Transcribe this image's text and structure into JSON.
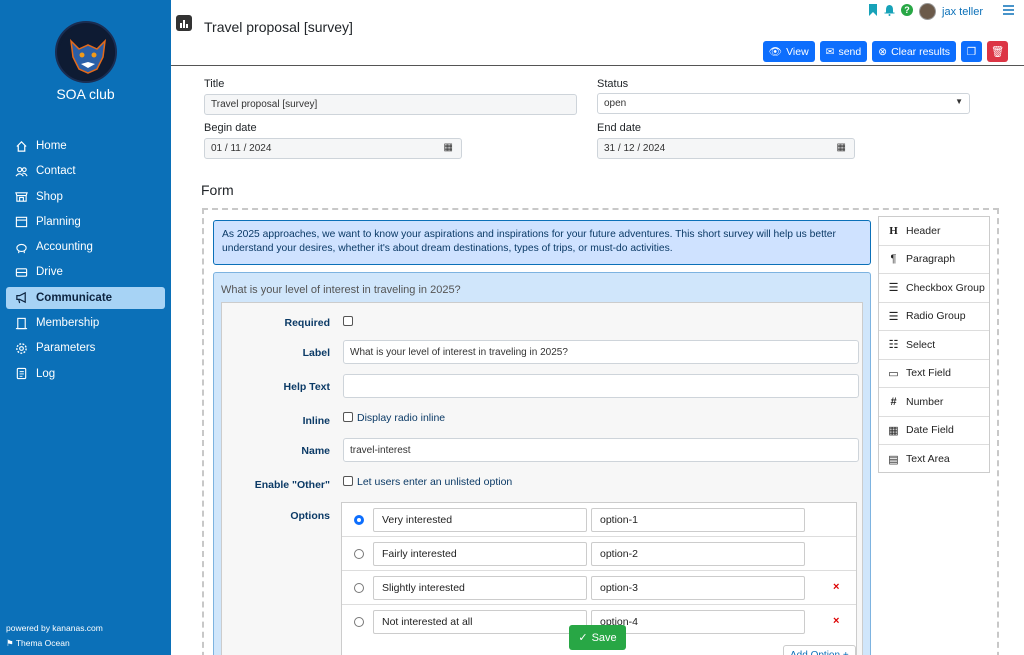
{
  "sidebar": {
    "club_name": "SOA club",
    "items": [
      {
        "label": "Home",
        "icon": "house-icon"
      },
      {
        "label": "Contact",
        "icon": "people-icon"
      },
      {
        "label": "Shop",
        "icon": "shop-icon"
      },
      {
        "label": "Planning",
        "icon": "calendar-icon"
      },
      {
        "label": "Accounting",
        "icon": "piggy-bank-icon"
      },
      {
        "label": "Drive",
        "icon": "drive-icon"
      },
      {
        "label": "Communicate",
        "icon": "megaphone-icon",
        "active": true
      },
      {
        "label": "Membership",
        "icon": "building-icon"
      },
      {
        "label": "Parameters",
        "icon": "gear-icon"
      },
      {
        "label": "Log",
        "icon": "journal-icon"
      }
    ],
    "powered_by": "powered by kananas.com",
    "theme": "Thema Ocean"
  },
  "header": {
    "title": "Travel proposal [survey]",
    "user_name": "jax teller",
    "buttons": {
      "view": "View",
      "send": "send",
      "clear": "Clear results"
    }
  },
  "fields": {
    "title_label": "Title",
    "title_value": "Travel proposal [survey]",
    "status_label": "Status",
    "status_value": "open",
    "begin_label": "Begin date",
    "begin_value": "01 / 11 / 2024",
    "end_label": "End date",
    "end_value": "31 / 12 / 2024"
  },
  "form": {
    "heading": "Form",
    "intro": "As 2025 approaches, we want to know your aspirations and inspirations for your future adventures. This short survey will help us better understand your desires, whether it's about dream destinations, types of trips, or must-do activities.",
    "question_title": "What is your level of interest in traveling in 2025?",
    "labels": {
      "required": "Required",
      "label": "Label",
      "help": "Help Text",
      "inline": "Inline",
      "name": "Name",
      "other": "Enable \"Other\"",
      "options": "Options"
    },
    "label_value": "What is your level of interest in traveling in 2025?",
    "help_value": "",
    "inline_text": "Display radio inline",
    "name_value": "travel-interest",
    "other_text": "Let users enter an unlisted option",
    "options": [
      {
        "label": "Very interested",
        "value": "option-1"
      },
      {
        "label": "Fairly interested",
        "value": "option-2"
      },
      {
        "label": "Slightly interested",
        "value": "option-3"
      },
      {
        "label": "Not interested at all",
        "value": "option-4"
      }
    ],
    "add_option": "Add Option +",
    "save": "Save"
  },
  "palette": [
    {
      "label": "Header",
      "icon": "header-icon"
    },
    {
      "label": "Paragraph",
      "icon": "paragraph-icon"
    },
    {
      "label": "Checkbox Group",
      "icon": "checklist-icon"
    },
    {
      "label": "Radio Group",
      "icon": "radio-list-icon"
    },
    {
      "label": "Select",
      "icon": "select-icon"
    },
    {
      "label": "Text Field",
      "icon": "text-field-icon"
    },
    {
      "label": "Number",
      "icon": "hash-icon"
    },
    {
      "label": "Date Field",
      "icon": "calendar-icon"
    },
    {
      "label": "Text Area",
      "icon": "textarea-icon"
    }
  ]
}
